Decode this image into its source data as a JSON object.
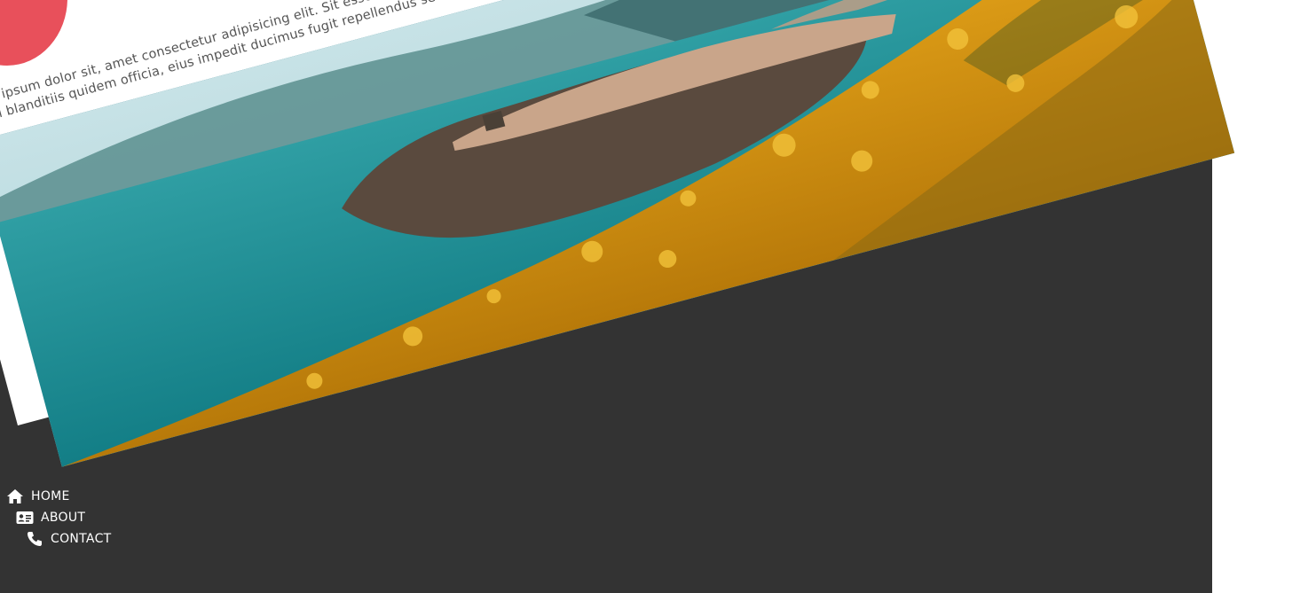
{
  "page": {
    "paragraph": "Lorem ipsum dolor sit, amet consectetur adipisicing elit. Sit esse totam sunt dignissimos deserunt libero consequatur magni blanditiis quidem officia, eius impedit ducimus fugit repellendus sed illo culpa."
  },
  "menu": {
    "toggle_color": "#e8505b",
    "close_icon": "close-icon",
    "open_icon": "hamburger-icon"
  },
  "nav": {
    "items": [
      {
        "label": "HOME",
        "icon": "home-icon"
      },
      {
        "label": "ABOUT",
        "icon": "id-card-icon"
      },
      {
        "label": "CONTACT",
        "icon": "phone-icon"
      }
    ]
  },
  "colors": {
    "dark_background": "#333333",
    "accent": "#e8505b",
    "text": "#555555"
  }
}
